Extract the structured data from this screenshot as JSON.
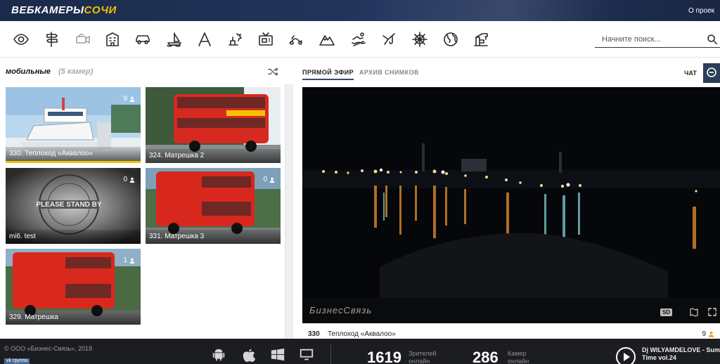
{
  "header": {
    "logo_main": "ВЕБКАМЕРЫ",
    "logo_accent": "СОЧИ",
    "about_link": "О проек",
    "accent_color": "#f2c200"
  },
  "toolbar": {
    "icons": [
      "eye-icon",
      "signpost-icon",
      "camera-icon",
      "building-icon",
      "car-icon",
      "sailboat-icon",
      "letter-a-icon",
      "dove-icon",
      "tv-icon",
      "snake-icon",
      "mountain-icon",
      "swimmer-icon",
      "fishing-icon",
      "ship-wheel-icon",
      "globe-icon",
      "crane-icon"
    ],
    "search_placeholder": "Начните поиск..."
  },
  "camera_list": {
    "title": "мобильные",
    "count": "(5 камер)",
    "cameras": [
      {
        "label": "330. Теплоход «Аквалоо»",
        "viewers": "9"
      },
      {
        "label": "324. Матрешка 2",
        "viewers": ""
      },
      {
        "label": "mi6. test",
        "viewers": "0"
      },
      {
        "label": "331. Матрешка 3",
        "viewers": "0"
      },
      {
        "label": "329. Матрешка",
        "viewers": "1"
      }
    ]
  },
  "stream": {
    "tab_live": "ПРЯМОЙ ЭФИР",
    "tab_archive": "АРХИВ СНИМКОВ",
    "chat": "ЧАТ",
    "watermark": "БизнесСвязь",
    "quality": "SD",
    "camera_number": "330",
    "camera_name": "Теплоход «Аквалоо»",
    "viewers": "9"
  },
  "footer": {
    "copyright": "© ООО «Бизнес-Связь», 2018",
    "social": "vk группа",
    "platforms": [
      "android-icon",
      "apple-icon",
      "windows-icon",
      "desktop-icon"
    ],
    "viewers_count": "1619",
    "viewers_label_1": "Зрителей",
    "viewers_label_2": "онлайн",
    "cameras_count": "286",
    "cameras_label_1": "Камер",
    "cameras_label_2": "онлайн",
    "radio_line1": "Dj WILYAMDELOVE - Summer",
    "radio_line2": "Time vol.24"
  }
}
